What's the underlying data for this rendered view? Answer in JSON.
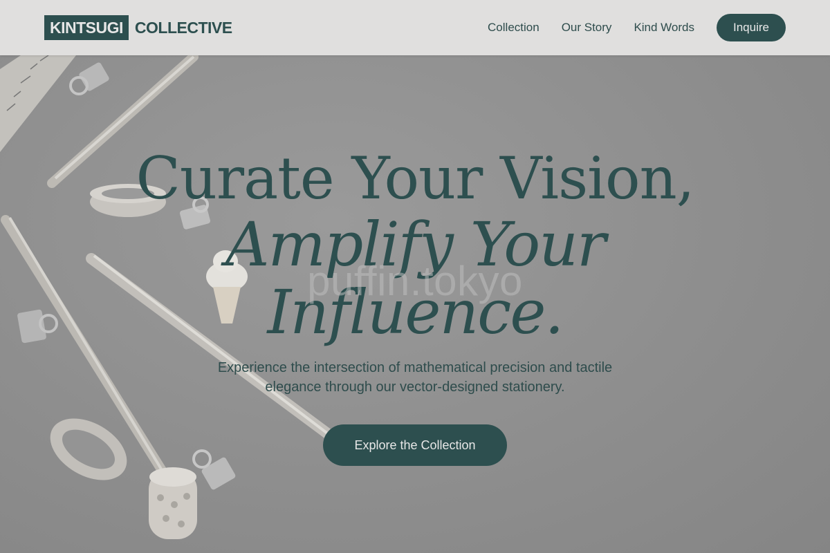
{
  "header": {
    "logo_primary": "KINTSUGI",
    "logo_secondary": "COLLECTIVE",
    "nav": [
      {
        "label": "Collection"
      },
      {
        "label": "Our Story"
      },
      {
        "label": "Kind Words"
      }
    ],
    "cta_label": "Inquire"
  },
  "hero": {
    "headline_line1": "Curate Your Vision,",
    "headline_line2": "Amplify Your",
    "headline_line3": "Influence.",
    "subtext": "Experience the intersection of mathematical precision and tactile elegance through our vector-designed stationery.",
    "cta_label": "Explore the Collection",
    "watermark": "puffin.tokyo"
  },
  "colors": {
    "brand": "#2d4f4f",
    "header_bg": "#e0dfde",
    "hero_bg": "#8f8f8f"
  },
  "icons": [
    "ruler-illustration",
    "pencil-illustration",
    "binder-clip-illustration",
    "washi-tape-illustration",
    "ice-cream-eraser-illustration"
  ]
}
